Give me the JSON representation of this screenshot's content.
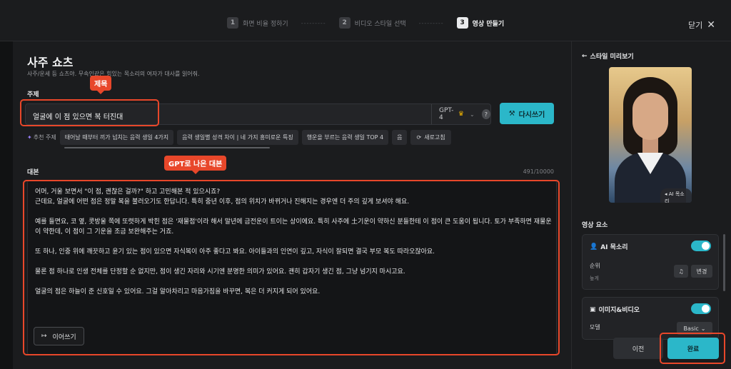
{
  "steps": [
    {
      "num": "1",
      "label": "화면 비율 정하기"
    },
    {
      "num": "2",
      "label": "비디오 스타일 선택"
    },
    {
      "num": "3",
      "label": "영상 만들기"
    }
  ],
  "step_separator": "---------",
  "close_label": "닫기",
  "page": {
    "title": "사주 쇼츠",
    "description": "사주/운세 등 쇼츠야. 무속인같은 힘있는 목소리의 여자가 대사를 읽어줘."
  },
  "topic": {
    "label": "주제",
    "value": "얼굴에 이 점 있으면 복 터진대",
    "model": "GPT-4",
    "rewrite_label": "다시쓰기"
  },
  "recommend": {
    "label": "추천 주제",
    "chips": [
      "태어날 때부터 끼가 넘치는 음력 생일 4가지",
      "음력 생일별 성격 차이 | 네 가지 흥미로운 특징",
      "행운을 부르는 음력 생일 TOP 4",
      "음"
    ],
    "refresh_label": "새로고침"
  },
  "script": {
    "label": "대본",
    "count": "491/10000",
    "paragraphs": [
      "어머, 거울 보면서 \"이 점, 괜찮은 걸까?\" 하고 고민해본 적 있으시죠?\n근데요, 얼굴에 어떤 점은 정말 복을 불러오기도 한답니다. 특히 중년 이후, 점의 위치가 바뀌거나 진해지는 경우엔 더 주의 깊게 보셔야 해요.",
      "예를 들면요, 코 옆, 콧방울 쪽에 또렷하게 박힌 점은 '재물점'이라 해서 말년에 금전운이 트이는 상이에요. 특히 사주에 土기운이 약하신 분들한테 이 점이 큰 도움이 됩니다. 토가 부족하면 재물운이 약한데, 이 점이 그 기운을 조금 보완해주는 거죠.",
      "또 하나, 인중 위에 깨끗하고 윤기 있는 점이 있으면 자식복이 아주 좋다고 봐요. 아이들과의 인연이 깊고, 자식이 잘되면 결국 부모 복도 따라오잖아요.",
      "물론 점 하나로 인생 전체를 단정할 순 없지만, 점이 생긴 자리와 시기엔 분명한 의미가 있어요. 괜히 갑자기 생긴 점, 그냥 넘기지 마시고요.",
      "얼굴의 점은 하늘이 준 신호일 수 있어요. 그걸 알아차리고 마음가짐을 바꾸면, 복은 더 커지게 되어 있어요."
    ],
    "continue_label": "이어쓰기"
  },
  "annotations": {
    "title_tag": "제목",
    "script_tag": "GPT로 나온 대본"
  },
  "side": {
    "preview_title": "스타일 미리보기",
    "voice_badge": "AI 목소리",
    "elements_title": "영상 요소",
    "voice_card": {
      "title": "AI 목소리",
      "sub_label": "순위",
      "sub_value": "높게",
      "change_label": "변경"
    },
    "media_card": {
      "title": "이미지&비디오",
      "model_label": "모델",
      "model_value": "Basic"
    },
    "prev_label": "이전",
    "done_label": "완료"
  },
  "colors": {
    "accent": "#2bb7c9",
    "annotation": "#e8472a"
  }
}
